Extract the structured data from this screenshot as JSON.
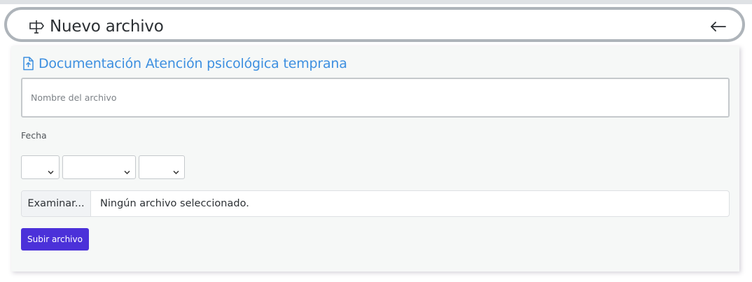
{
  "header": {
    "title": "Nuevo archivo",
    "leading_icon": "signpost-icon",
    "back_icon": "arrow-left-icon"
  },
  "panel": {
    "section_title": "Documentación Atención psicológica temprana",
    "section_icon": "file-upload-icon",
    "name_field": {
      "placeholder": "Nombre del archivo",
      "value": ""
    },
    "date": {
      "label": "Fecha",
      "day_value": "",
      "month_value": "",
      "year_value": ""
    },
    "file_input": {
      "browse_label": "Examinar...",
      "status_text": "Ningún archivo seleccionado."
    },
    "submit_label": "Subir archivo"
  },
  "colors": {
    "accent_blue": "#3d8fe0",
    "primary_button": "#4b31d9",
    "header_border": "#aeb4ba",
    "panel_background": "#f6f8f7"
  }
}
